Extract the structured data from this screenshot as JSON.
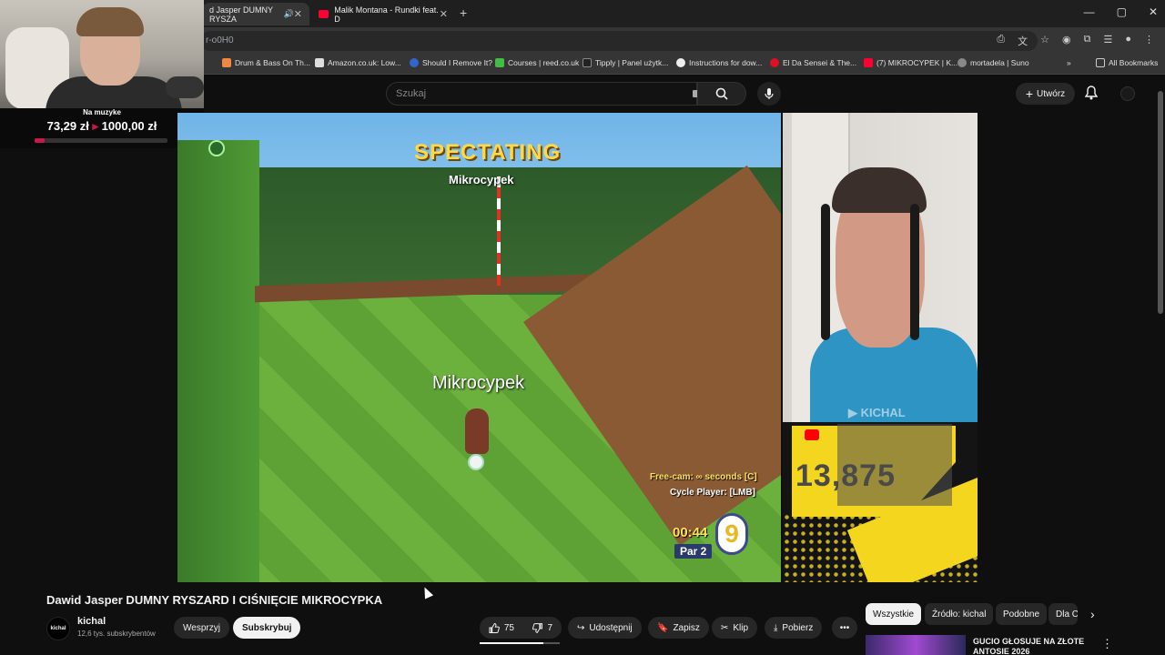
{
  "browser": {
    "tabs": [
      {
        "label": "d Jasper DUMNY RYSZA",
        "active": true
      },
      {
        "label": "Malik Montana - Rundki feat. D",
        "active": false
      }
    ],
    "url": "r-o0H0",
    "bookmarks": [
      "Drum & Bass On Th...",
      "Amazon.co.uk: Low...",
      "Should I Remove It?",
      "Courses | reed.co.uk",
      "Tipply | Panel użytk...",
      "Instructions for dow...",
      "El Da Sensei & The...",
      "(7) MIKROCYPEK | K...",
      "mortadela | Suno"
    ],
    "all_bookmarks": "All Bookmarks"
  },
  "overlay": {
    "donation_label": "Na muzyke",
    "donation_amount": "73,29 zł",
    "donation_goal": "1000,00 zł",
    "donation_progress": 0.073
  },
  "youtube": {
    "search_placeholder": "Szukaj",
    "create_label": "Utwórz"
  },
  "game": {
    "spectating": "SPECTATING",
    "spectated_name": "Mikrocypek",
    "player_label": "Mikrocypek",
    "freecam": "Free-cam: ∞ seconds [C]",
    "cycle": "Cycle Player: [LMB]",
    "timer": "00:44",
    "par": "Par 2",
    "hole_number": "9"
  },
  "side_cam": {
    "watermark": "KICHAL",
    "sub_count": "13,875"
  },
  "video": {
    "title": "Dawid Jasper DUMNY RYSZARD I CIŚNIĘCIE MIKROCYPKA",
    "channel": "kichal",
    "channel_avatar_text": "kichal",
    "subscribers": "12,6 tys. subskrybentów",
    "support_label": "Wesprzyj",
    "subscribe_label": "Subskrybuj",
    "likes": "75",
    "dislikes": "7",
    "share_label": "Udostępnij",
    "save_label": "Zapisz",
    "clip_label": "Klip",
    "download_label": "Pobierz"
  },
  "chips": [
    "Wszystkie",
    "Źródło: kichal",
    "Podobne",
    "Dla C"
  ],
  "recommended": {
    "title": "GUCIO GŁOSUJE NA ZŁOTE ANTOSIE 2026"
  },
  "colors": {
    "background": "#0f0f0f",
    "accent_red": "#ff0000",
    "hud_yellow": "#ffe25a",
    "donation_bar": "#c9184a"
  }
}
